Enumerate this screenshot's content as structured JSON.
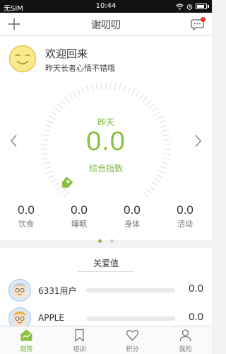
{
  "status_bar": {
    "carrier": "无SIM",
    "time": "10:44"
  },
  "nav": {
    "title": "谢叨叨",
    "left_icon": "plus-icon",
    "right_icon": "chat-bubble-icon",
    "notification_color": "#e8392f"
  },
  "welcome": {
    "title": "欢迎回来",
    "subtitle": "昨天长者心情不错哦",
    "avatar_icon": "smiley-face-icon"
  },
  "gauge": {
    "day": "昨天",
    "value": "0.0",
    "label": "综合指数",
    "accent_color": "#8ac03f"
  },
  "stats": [
    {
      "value": "0.0",
      "label": "饮食"
    },
    {
      "value": "0.0",
      "label": "睡眠"
    },
    {
      "value": "0.0",
      "label": "身体"
    },
    {
      "value": "0.0",
      "label": "活动"
    }
  ],
  "pager": {
    "pages": 2,
    "active": 0
  },
  "care": {
    "title": "关爱值",
    "rows": [
      {
        "name": "6331用户",
        "value": "0.0",
        "progress": 0
      },
      {
        "name": "APPLE",
        "value": "0.0",
        "progress": 0
      }
    ]
  },
  "tabs": [
    {
      "label": "趋势",
      "icon": "home-chart-icon",
      "active": true
    },
    {
      "label": "培训",
      "icon": "bookmark-icon",
      "active": false
    },
    {
      "label": "积分",
      "icon": "heart-icon",
      "active": false
    },
    {
      "label": "我的",
      "icon": "person-icon",
      "active": false
    }
  ]
}
